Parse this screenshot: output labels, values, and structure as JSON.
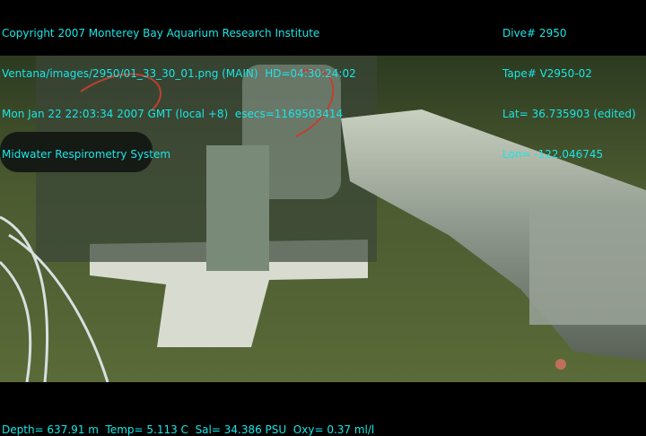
{
  "overlay_top_left": [
    "Copyright 2007 Monterey Bay Aquarium Research Institute",
    "Ventana/images/2950/01_33_30_01.png (MAIN)  HD=04:30:24:02",
    "Mon Jan 22 22:03:34 2007 GMT (local +8)  esecs=1169503414",
    "Midwater Respirometry System"
  ],
  "overlay_top_right": [
    "Dive# 2950",
    "Tape# V2950-02",
    "Lat= 36.735903 (edited)",
    "Lon= -122.046745"
  ],
  "overlay_bottom": "Depth= 637.91 m  Temp= 5.113 C  Sal= 34.386 PSU  Oxy= 0.37 ml/l",
  "colors": {
    "overlay_text": "#19e6e6",
    "seafloor": "#4a5a2c"
  }
}
